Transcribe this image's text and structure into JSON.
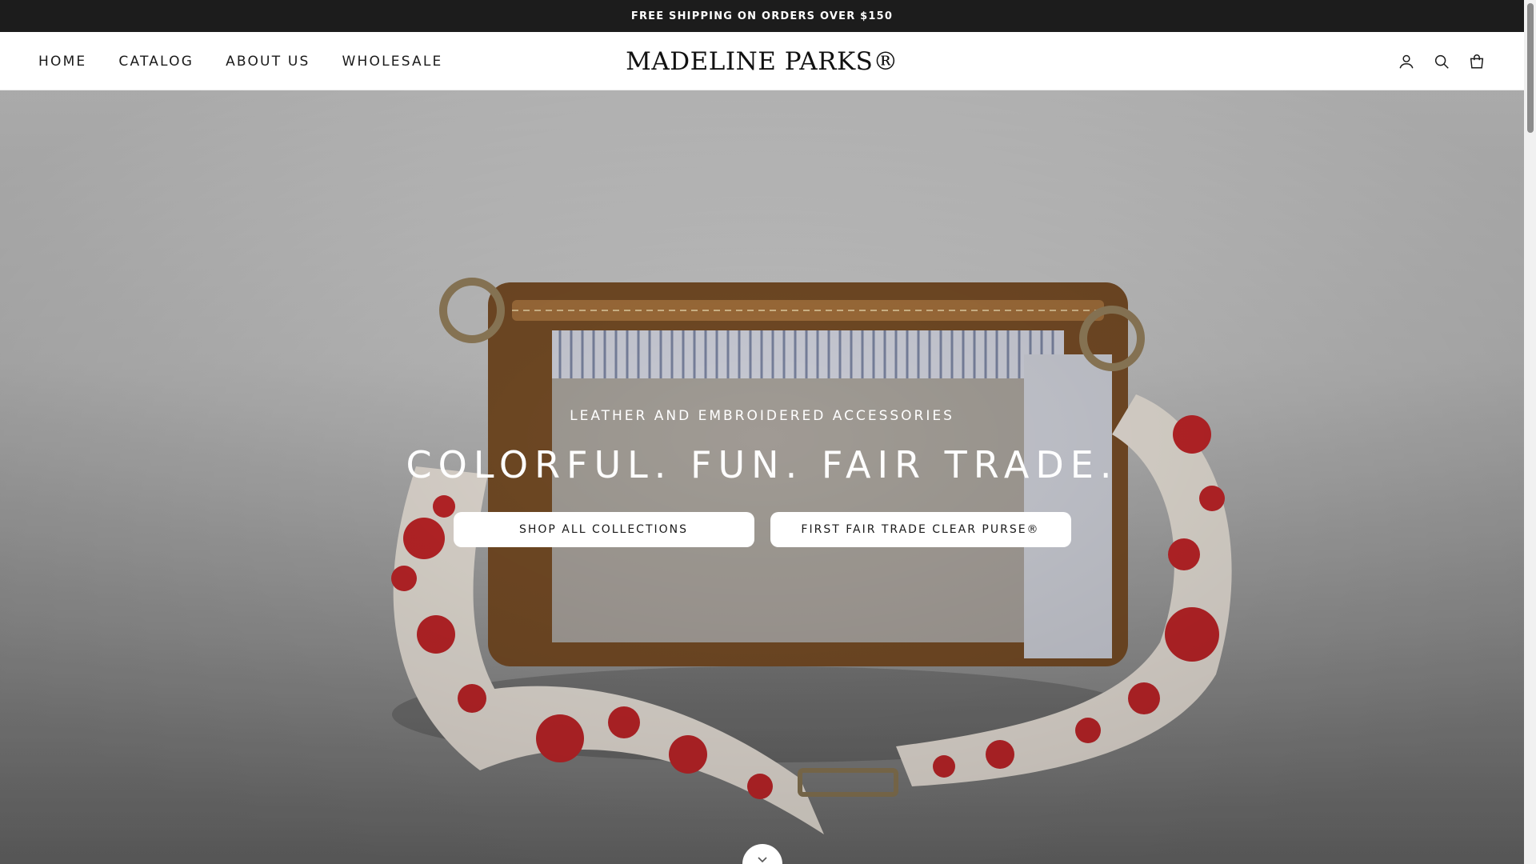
{
  "announcement": {
    "text": "FREE SHIPPING ON ORDERS OVER $150"
  },
  "header": {
    "nav": [
      {
        "label": "HOME"
      },
      {
        "label": "CATALOG"
      },
      {
        "label": "ABOUT US"
      },
      {
        "label": "WHOLESALE"
      }
    ],
    "logo": "MADELINE PARKS®",
    "icons": [
      "account-icon",
      "search-icon",
      "cart-icon"
    ]
  },
  "hero": {
    "subtitle": "LEATHER AND EMBROIDERED ACCESSORIES",
    "title": "COLORFUL. FUN. FAIR TRADE.",
    "buttons": [
      {
        "label": "SHOP ALL COLLECTIONS"
      },
      {
        "label": "FIRST FAIR TRADE CLEAR PURSE®"
      }
    ],
    "scroll_icon": "chevron-down-icon"
  },
  "colors": {
    "announcement_bg": "#1c1c1c",
    "embroidery_red": "#c8272b",
    "leather_brown": "#8a5a2b",
    "strap_cream": "#efe8df"
  }
}
